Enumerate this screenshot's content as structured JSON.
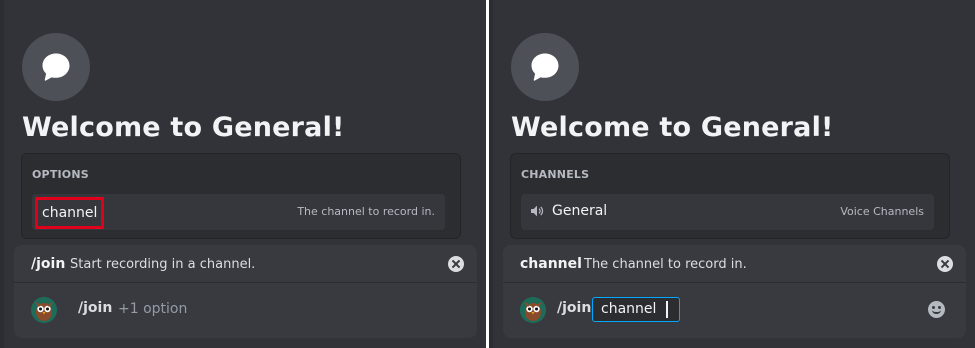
{
  "left": {
    "welcome": "Welcome to General!",
    "popup": {
      "heading": "OPTIONS",
      "item_name": "channel",
      "item_desc": "The channel to record in."
    },
    "command": {
      "name": "/join",
      "description": "Start recording in a channel.",
      "input_command": "/join",
      "input_hint": "+1 option"
    }
  },
  "right": {
    "welcome": "Welcome to General!",
    "popup": {
      "heading": "CHANNELS",
      "item_name": "General",
      "item_desc": "Voice Channels"
    },
    "command": {
      "name": "channel",
      "description": "The channel to record in.",
      "input_command": "/join",
      "input_value": "channel"
    }
  },
  "colors": {
    "background": "#313338",
    "popup": "#2b2d31",
    "highlight_outline": "#e0001b",
    "focus_border": "#00a8fc"
  },
  "icons": {
    "channel_hero": "chat-bubble-icon",
    "close": "close-circle-icon",
    "speaker": "speaker-icon",
    "emoji": "smile-icon",
    "avatar": "bot-avatar"
  }
}
